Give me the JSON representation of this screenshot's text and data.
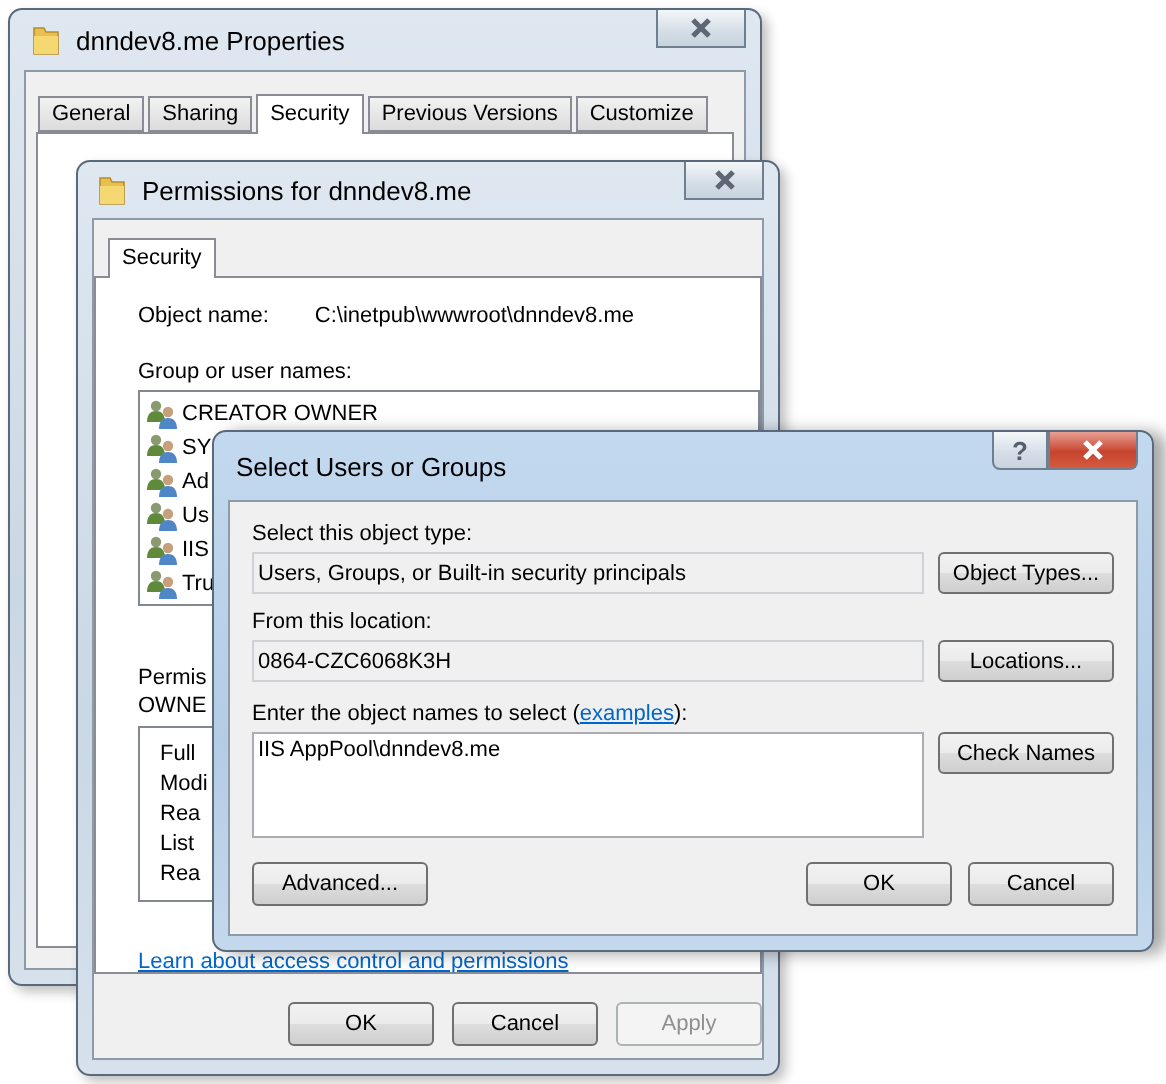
{
  "properties_window": {
    "title": "dnndev8.me Properties",
    "tabs": [
      {
        "label": "General",
        "selected": false
      },
      {
        "label": "Sharing",
        "selected": false
      },
      {
        "label": "Security",
        "selected": true
      },
      {
        "label": "Previous Versions",
        "selected": false
      },
      {
        "label": "Customize",
        "selected": false
      }
    ]
  },
  "permissions_window": {
    "title": "Permissions for dnndev8.me",
    "tabs": [
      {
        "label": "Security",
        "selected": true
      }
    ],
    "object_name_label": "Object name:",
    "object_name": "C:\\inetpub\\wwwroot\\dnndev8.me",
    "group_label": "Group or user names:",
    "groups": [
      "CREATOR OWNER",
      "SY",
      "Ad",
      "Us",
      "IIS",
      "Tru"
    ],
    "permissions_label": [
      "Permis",
      "OWNE"
    ],
    "permissions": [
      "Full",
      "Modi",
      "Rea",
      "List",
      "Rea"
    ],
    "link": "Learn about access control and permissions",
    "buttons": [
      {
        "label": "OK",
        "disabled": false
      },
      {
        "label": "Cancel",
        "disabled": false
      },
      {
        "label": "Apply",
        "disabled": true
      }
    ]
  },
  "select_dialog": {
    "title": "Select Users or Groups",
    "help": "?",
    "object_type_label": "Select this object type:",
    "object_type": "Users, Groups, or Built-in security principals",
    "object_types_button": "Object Types...",
    "location_label": "From this location:",
    "location": "0864-CZC6068K3H",
    "locations_button": "Locations...",
    "names_label": {
      "before": "Enter the object names to select (",
      "link": "examples",
      "after": "):"
    },
    "names_value": "IIS AppPool\\dnndev8.me",
    "check_names_button": "Check Names",
    "advanced_button": "Advanced...",
    "ok_button": "OK",
    "cancel_button": "Cancel"
  }
}
